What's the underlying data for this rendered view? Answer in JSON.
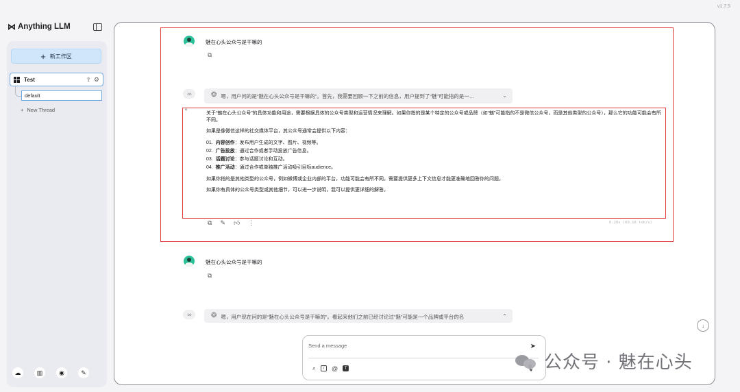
{
  "app": {
    "version": "v1.7.5",
    "brand": "Anything LLM"
  },
  "sidebar": {
    "new_workspace_label": "新工作区",
    "workspace": {
      "name": "Test"
    },
    "thread": {
      "name": "default"
    },
    "new_thread_label": "New Thread"
  },
  "chat": {
    "msg1": {
      "text": "魅在心头公众号是干嘛的"
    },
    "thought1": {
      "text": "嗯，用户问的是“魅在心头公众号是干嘛的”。首先，我需要回顾一下之前的信息，用户提到了“魅”可能指的是一…"
    },
    "answer": {
      "intro": "关于“魅在心头公众号”的具体功能和用途，需要根据具体的公众号类型和运营情况来理解。如果你指的是某个特定的公众号或品牌（如“魅”可能指的不是微信公众号，而是其他类型的公众号），那么它的功能可能会有所不同。",
      "lead": "如果是像微信这样的社交媒体平台，其公众号通常会提供以下内容：",
      "items": [
        {
          "num": "01.",
          "title": "内容创作",
          "desc": "：发布用户生成的文字、图片、视频等。"
        },
        {
          "num": "02.",
          "title": "广告投放",
          "desc": "：通过合作或者手动投放广告信息。"
        },
        {
          "num": "03.",
          "title": "话题讨论",
          "desc": "：参与话题讨论和互动。"
        },
        {
          "num": "04.",
          "title": "推广活动",
          "desc": "：通过合作或单独推广活动吸引目标audience。"
        }
      ],
      "p2": "如果你指的是其他类型的公众号，例如微博或企业内部的平台，功能可能会有所不同。需要提供更多上下文信息才能更准确地回答你的问题。",
      "p3": "如果你有具体的公众号类型或其他细节，可以进一步说明，我可以提供更详细的解答。",
      "perf": "6.20s (60.18 tok/s)"
    },
    "msg2": {
      "text": "魅在心头公众号是干嘛的"
    },
    "thought2": {
      "text": "嗯，用户现在问的是“魅在心头公众号是干嘛的”。看起来他们之前已经讨论过“魅”可能是一个品牌或平台的名"
    }
  },
  "composer": {
    "placeholder": "Send a message"
  },
  "watermark": {
    "text": "公众号 · 魅在心头"
  },
  "colors": {
    "accent": "#cfe6fb",
    "annotation": "#e03a3a",
    "user_avatar": "#2cc09a"
  }
}
